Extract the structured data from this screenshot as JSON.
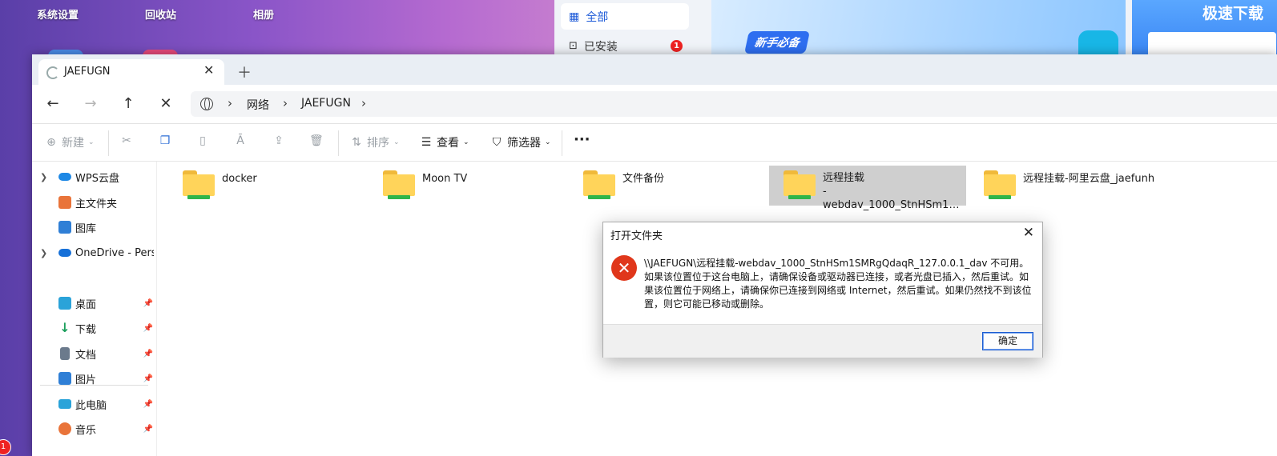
{
  "desktop": {
    "icons": [
      "系统设置",
      "回收站",
      "相册"
    ],
    "notification_badge": "1"
  },
  "app_store": {
    "nav": [
      {
        "label": "全部",
        "icon": "grid-icon"
      },
      {
        "label": "已安装",
        "icon": "download-box-icon",
        "badge": "1"
      }
    ],
    "banner_tag": "新手必备",
    "banner2_title": "极速下载"
  },
  "explorer": {
    "tab_title": "JAEFUGN",
    "breadcrumb": [
      "网络",
      "JAEFUGN"
    ],
    "toolbar": {
      "new": "新建",
      "sort": "排序",
      "view": "查看",
      "filter": "筛选器",
      "more": "···"
    },
    "sidebar": [
      {
        "label": "WPS云盘",
        "icon": "cloud-icon",
        "color": "#1e88e5",
        "expandable": true
      },
      {
        "label": "主文件夹",
        "icon": "home-icon",
        "color": "#e9743a"
      },
      {
        "label": "图库",
        "icon": "gallery-icon",
        "color": "#2f7fd6"
      },
      {
        "label": "OneDrive - Personal",
        "icon": "onedrive-icon",
        "color": "#1670d8",
        "expandable": true
      },
      {
        "label": "桌面",
        "icon": "desktop-icon",
        "color": "#2aa3d9",
        "pinned": true
      },
      {
        "label": "下载",
        "icon": "download-icon",
        "color": "#1b9e5c",
        "pinned": true
      },
      {
        "label": "文档",
        "icon": "document-icon",
        "color": "#6b7a8c",
        "pinned": true
      },
      {
        "label": "图片",
        "icon": "pictures-icon",
        "color": "#2f7fd6",
        "pinned": true
      },
      {
        "label": "此电脑",
        "icon": "computer-icon",
        "color": "#2aa3d9",
        "pinned": true
      },
      {
        "label": "音乐",
        "icon": "music-icon",
        "color": "#e9743a",
        "pinned": true
      }
    ],
    "folders": [
      {
        "name": "docker",
        "selected": false
      },
      {
        "name": "Moon TV",
        "selected": false
      },
      {
        "name": "文件备份",
        "selected": false
      },
      {
        "name": "远程挂载\n-webdav_1000_StnHSm1SMRg...",
        "selected": true
      },
      {
        "name": "远程挂载-阿里云盘_jaefunh",
        "selected": false
      }
    ]
  },
  "dialog": {
    "title": "打开文件夹",
    "message": "\\\\JAEFUGN\\远程挂载-webdav_1000_StnHSm1SMRgQdaqR_127.0.0.1_dav 不可用。如果该位置位于这台电脑上，请确保设备或驱动器已连接，或者光盘已插入，然后重试。如果该位置位于网络上，请确保你已连接到网络或 Internet，然后重试。如果仍然找不到该位置，则它可能已移动或删除。",
    "ok_label": "确定"
  }
}
